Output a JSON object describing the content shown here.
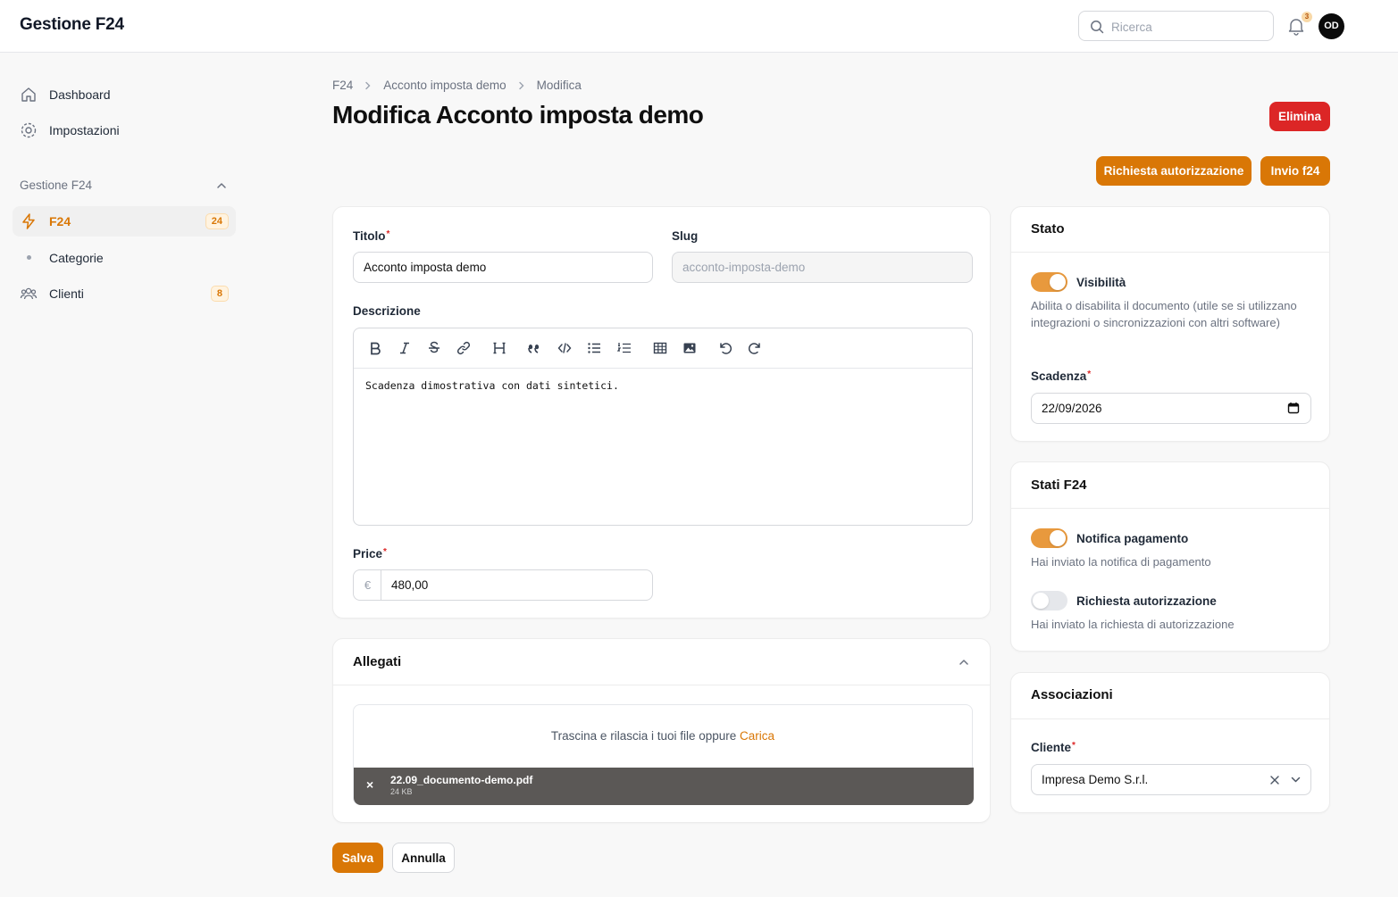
{
  "app": {
    "title": "Gestione F24"
  },
  "header": {
    "search_placeholder": "Ricerca",
    "notifications_count": "3",
    "avatar_initials": "OD"
  },
  "sidebar": {
    "items": [
      {
        "label": "Dashboard",
        "icon": "home-icon"
      },
      {
        "label": "Impostazioni",
        "icon": "gear-icon"
      }
    ],
    "group_label": "Gestione F24",
    "group_items": [
      {
        "label": "F24",
        "icon": "bolt-icon",
        "count": "24",
        "active": true
      },
      {
        "label": "Categorie",
        "icon": "dot"
      },
      {
        "label": "Clienti",
        "icon": "users-icon",
        "count": "8"
      }
    ]
  },
  "breadcrumb": [
    "F24",
    "Acconto imposta demo",
    "Modifica"
  ],
  "page": {
    "title": "Modifica Acconto imposta demo",
    "delete_label": "Elimina",
    "auth_request_label": "Richiesta autorizzazione",
    "send_label": "Invio f24"
  },
  "form": {
    "title_label": "Titolo",
    "title_value": "Acconto imposta demo",
    "slug_label": "Slug",
    "slug_value": "acconto-imposta-demo",
    "description_label": "Descrizione",
    "description_value": "Scadenza dimostrativa con dati sintetici.",
    "price_label": "Price",
    "price_prefix": "€",
    "price_value": "480,00"
  },
  "attachments": {
    "title": "Allegati",
    "dropzone_text": "Trascina e rilascia i tuoi file oppure",
    "dropzone_link": "Carica",
    "file_name": "22.09_documento-demo.pdf",
    "file_size": "24 KB"
  },
  "stato": {
    "title": "Stato",
    "visibility_label": "Visibilità",
    "visibility_on": true,
    "visibility_help": "Abilita o disabilita il documento (utile se si utilizzano integrazioni o sincronizzazioni con altri software)",
    "deadline_label": "Scadenza",
    "deadline_value": "22/09/2026"
  },
  "stati_f24": {
    "title": "Stati F24",
    "payment_label": "Notifica pagamento",
    "payment_on": true,
    "payment_help": "Hai inviato la notifica di pagamento",
    "auth_label": "Richiesta autorizzazione",
    "auth_on": false,
    "auth_help": "Hai inviato la richiesta di autorizzazione"
  },
  "associazioni": {
    "title": "Associazioni",
    "client_label": "Cliente",
    "client_value": "Impresa Demo S.r.l."
  },
  "footer": {
    "save_label": "Salva",
    "cancel_label": "Annulla"
  },
  "colors": {
    "accent": "#d97706",
    "danger": "#dc2626",
    "toggle_on": "#e8993d"
  }
}
